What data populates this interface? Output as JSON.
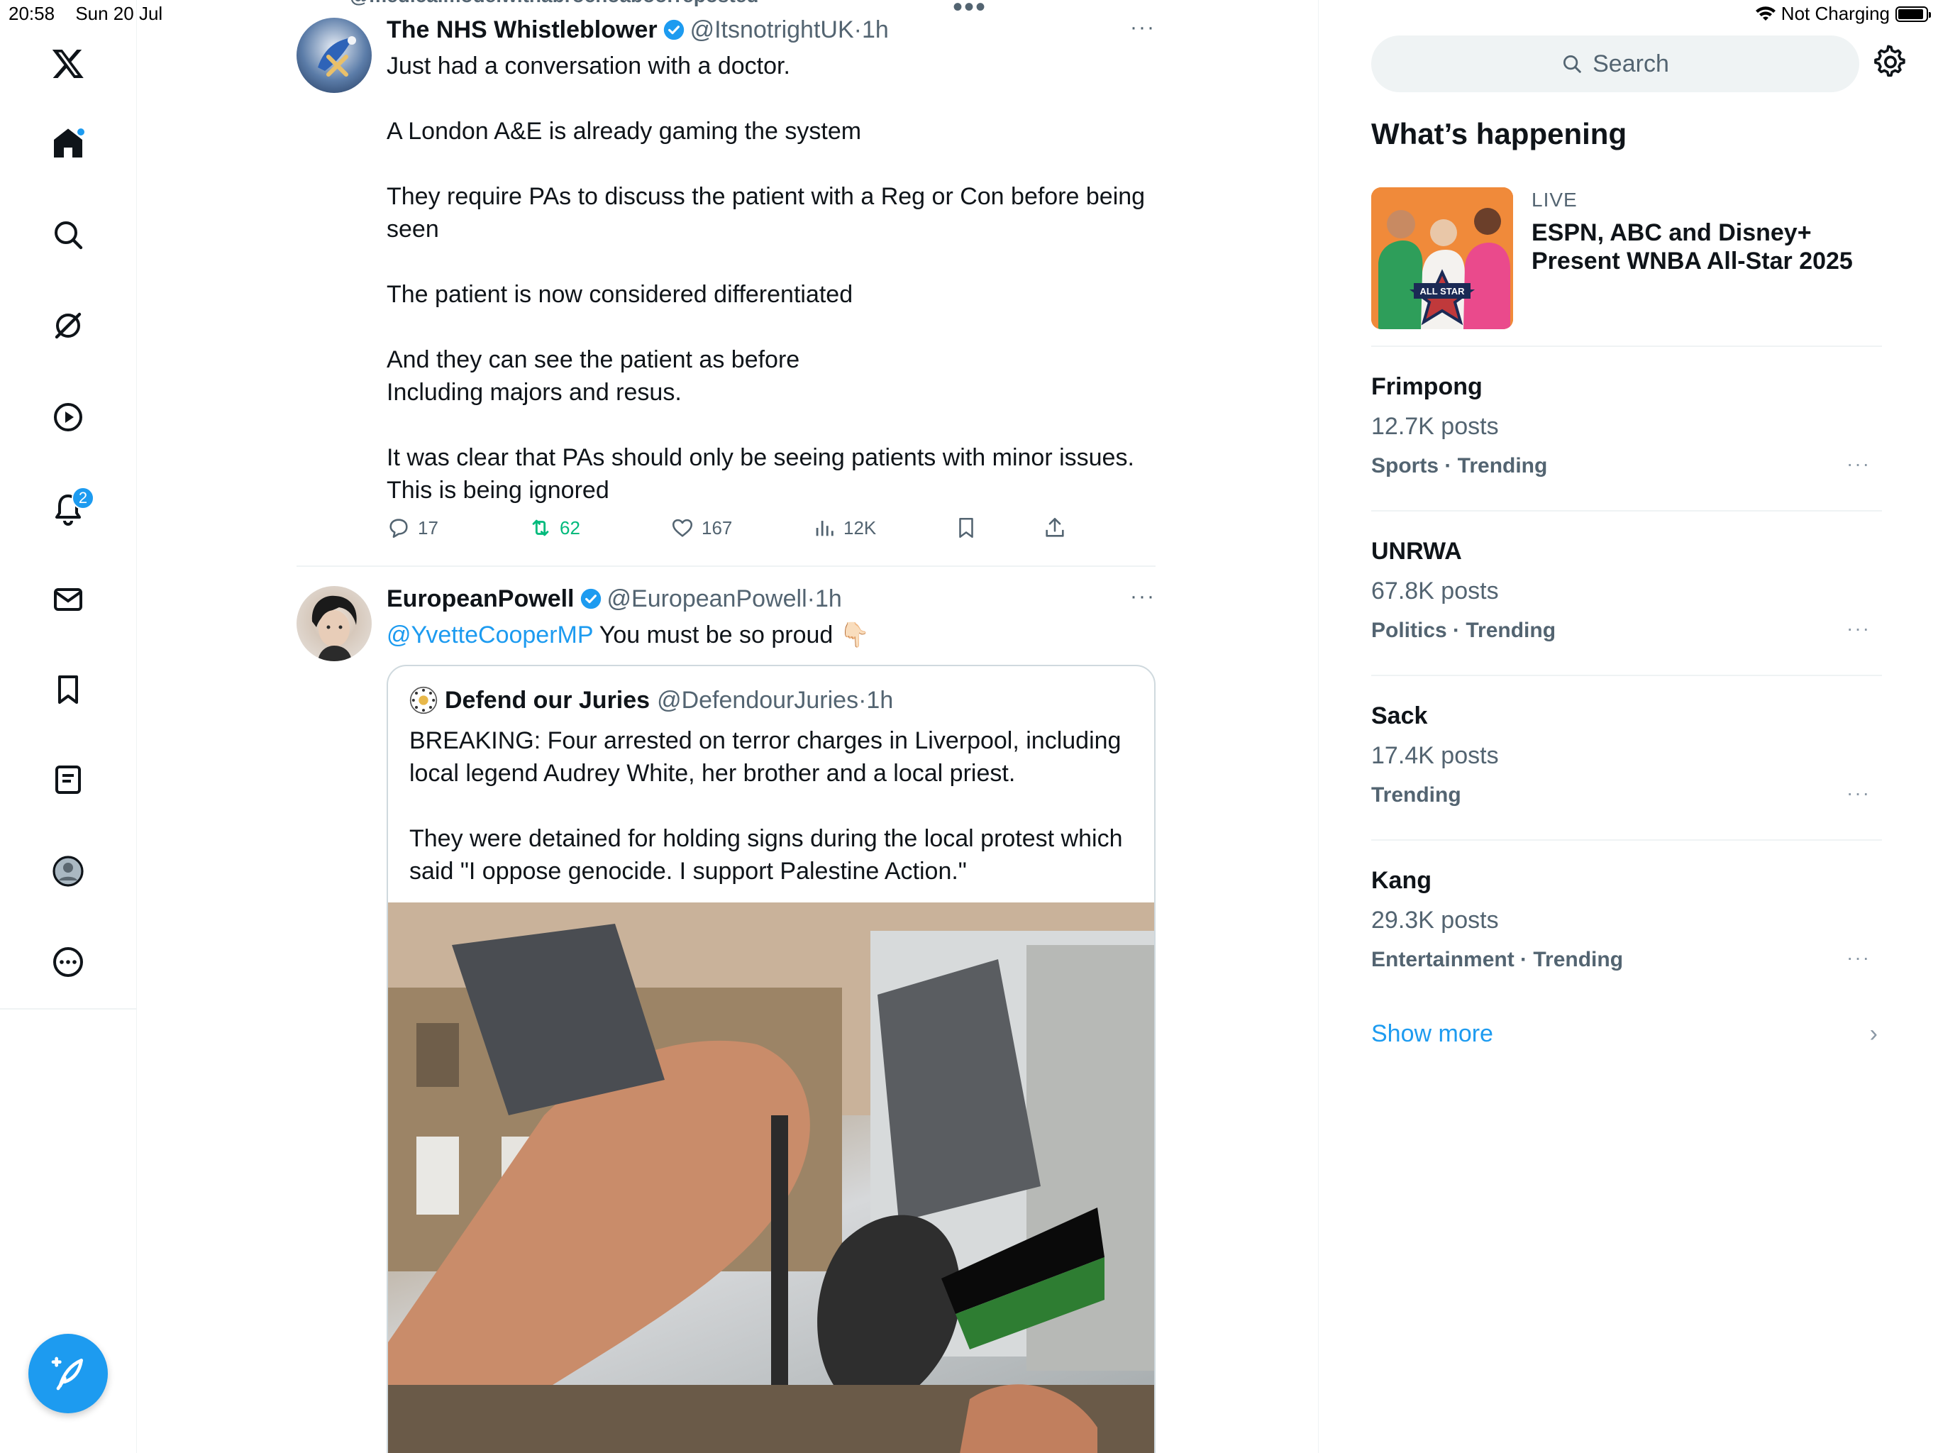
{
  "status_bar": {
    "time": "20:58",
    "date": "Sun 20 Jul",
    "charging_text": "Not Charging"
  },
  "nav": {
    "notifications_count": "2",
    "items": [
      "x-logo",
      "home",
      "search",
      "grok",
      "video",
      "notifications",
      "messages",
      "bookmarks",
      "lists",
      "profile",
      "more"
    ]
  },
  "feed": {
    "repost_header": "@medicalmodelwithabrochoaboorreposted",
    "tweet1": {
      "name": "The NHS Whistleblower",
      "handle": "@ItsnotrightUK",
      "dot": "·",
      "time": "1h",
      "more": "···",
      "lines": [
        "Just had a conversation with a doctor.",
        "",
        "A London A&E is already gaming the system",
        "",
        "They require PAs to discuss the patient with a Reg or Con before being seen",
        "",
        "The patient is now considered differentiated",
        "",
        "And they can see the patient as before",
        "Including majors and resus.",
        "",
        "It was clear that PAs should only be seeing patients with minor issues. This is being ignored"
      ],
      "replies": "17",
      "reposts": "62",
      "likes": "167",
      "views": "12K"
    },
    "tweet2": {
      "name": "EuropeanPowell",
      "handle": "@EuropeanPowell",
      "dot": "·",
      "time": "1h",
      "more": "···",
      "mention": "@YvetteCooperMP",
      "text": " You must be so proud 👇🏻",
      "quote": {
        "name": "Defend our Juries",
        "handle": "@DefendourJuries",
        "dot": "·",
        "time": "1h",
        "line1": "BREAKING: Four arrested on terror charges in Liverpool, including local legend Audrey White, her brother and a local priest.",
        "line2": "They were detained for holding signs during the local protest which said \"I oppose genocide. I support Palestine Action.\""
      }
    }
  },
  "sidebar_right": {
    "search_placeholder": "Search",
    "section_title": "What’s happening",
    "live": {
      "label": "LIVE",
      "title": "ESPN, ABC and Disney+ Present WNBA All-Star 2025",
      "thumb_text": "ALL STAR"
    },
    "trends": [
      {
        "name": "Frimpong",
        "count": "12.7K posts",
        "category": "Sports · Trending"
      },
      {
        "name": "UNRWA",
        "count": "67.8K posts",
        "category": "Politics · Trending"
      },
      {
        "name": "Sack",
        "count": "17.4K posts",
        "category": "Trending"
      },
      {
        "name": "Kang",
        "count": "29.3K posts",
        "category": "Entertainment · Trending"
      }
    ],
    "trend_more": "···",
    "show_more": "Show more",
    "show_more_chevron": "›"
  },
  "colors": {
    "accent": "#1d9bf0",
    "retweet_green": "#00ba7c",
    "text_primary": "#0f1419",
    "text_secondary": "#536471"
  }
}
